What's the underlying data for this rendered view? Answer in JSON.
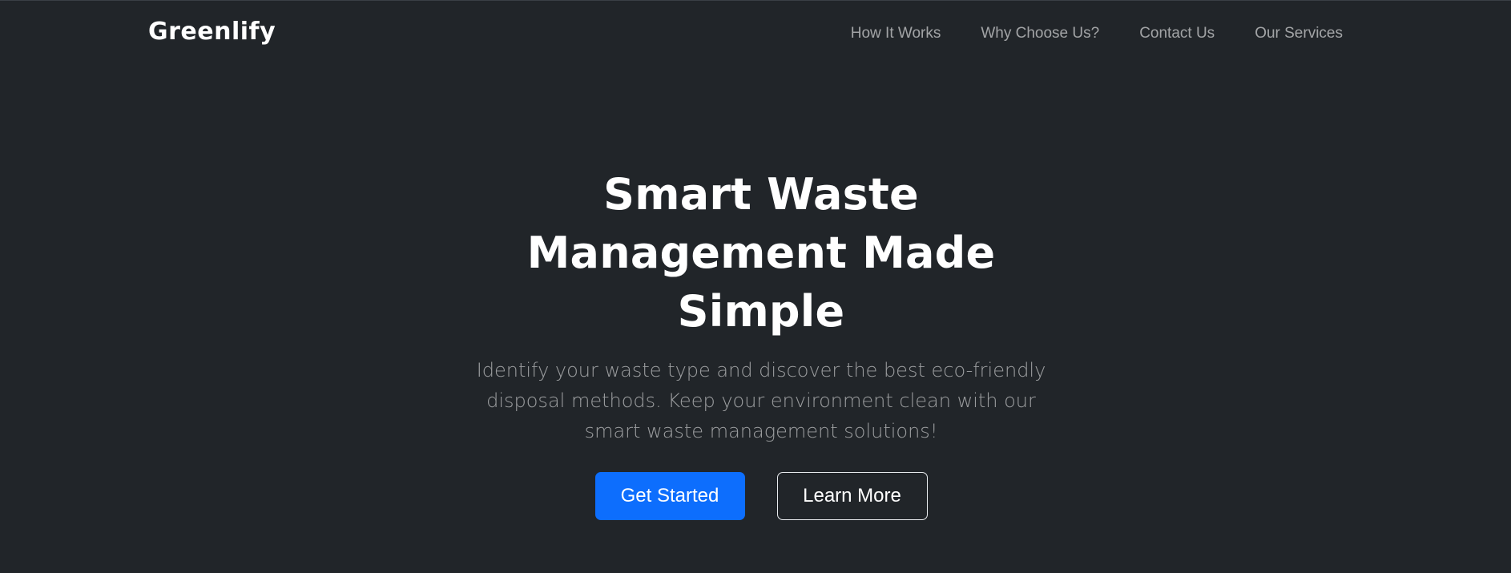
{
  "navbar": {
    "brand": "Greenlify",
    "links": [
      {
        "label": "How It Works"
      },
      {
        "label": "Why Choose Us?"
      },
      {
        "label": "Contact Us"
      },
      {
        "label": "Our Services"
      }
    ]
  },
  "hero": {
    "title": "Smart Waste Management Made Simple",
    "lead": "Identify your waste type and discover the best eco-friendly disposal methods. Keep your environment clean with our smart waste management solutions!",
    "primary_button": "Get Started",
    "secondary_button": "Learn More"
  },
  "colors": {
    "background": "#212529",
    "primary": "#0d6efd",
    "text": "#ffffff",
    "muted_text": "#8c8f93"
  }
}
